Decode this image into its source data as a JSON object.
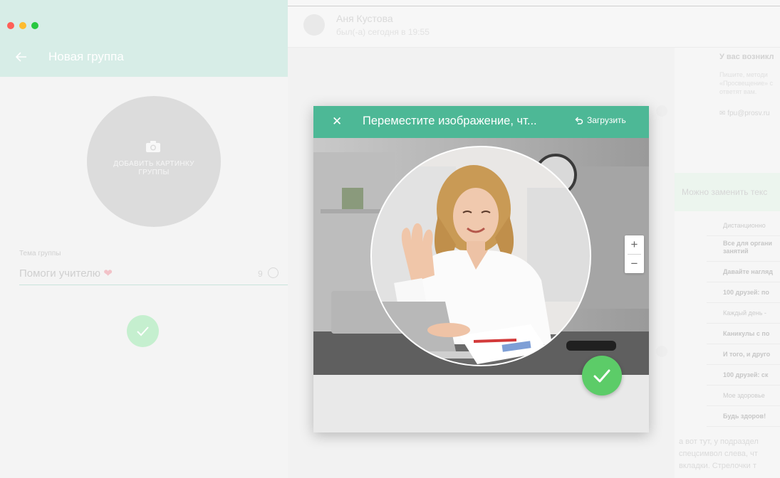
{
  "window": {
    "traffic_colors": [
      "#ff5f57",
      "#febc2e",
      "#28c840"
    ]
  },
  "left_panel": {
    "title": "Новая группа",
    "avatar_label": "ДОБАВИТЬ КАРТИНКУ ГРУППЫ",
    "topic_label": "Тема группы",
    "topic_value": "Помоги учителю",
    "topic_emoji": "❤",
    "char_count": "9",
    "accent_color": "#4db896"
  },
  "chat_header": {
    "contact_name": "Аня Кустова",
    "contact_status": "был(-а) сегодня в 19:55"
  },
  "right_panel": {
    "info_heading": "У вас возникл",
    "info_body": "Пишите, методи «Просвещение» с ответят вам.",
    "info_email": "fpu@prosv.ru",
    "replace_text": "Можно заменить текс",
    "menu_items": [
      "Дистанционно",
      "Все для органи занятий",
      "Давайте нагляд",
      "100 друзей: по",
      "Каждый день -",
      "Каникулы с по",
      "И того, и друго",
      "100 друзей: ск",
      "Мое здоровье",
      "Будь здоров!"
    ],
    "bottom_text": [
      "а вот тут, у подраздел",
      "спецсимвол слева, чт",
      "вкладки. Стрелочки т"
    ]
  },
  "modal": {
    "title": "Переместите изображение, чт...",
    "upload_label": "Загрузить",
    "zoom_in": "+",
    "zoom_out": "−",
    "header_color": "#4db896",
    "confirm_color": "#5ccc68"
  }
}
